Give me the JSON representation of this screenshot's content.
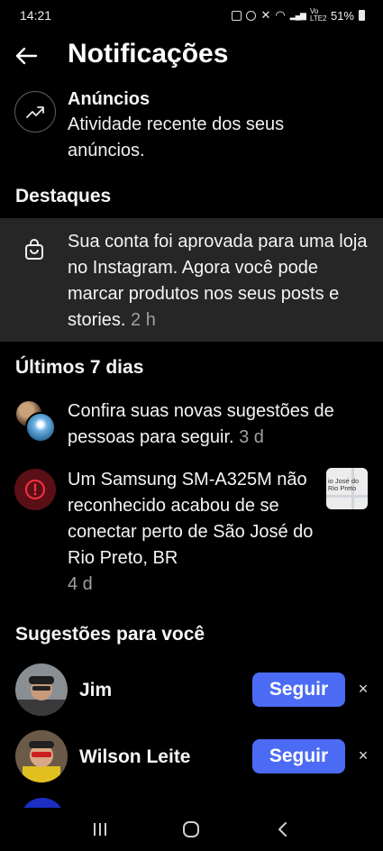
{
  "status_bar": {
    "time": "14:21",
    "signal_text": "Vo LTE2",
    "battery": "51%"
  },
  "header": {
    "title": "Notificações",
    "back_icon": "arrow-left-icon"
  },
  "ads": {
    "title": "Anúncios",
    "subtitle": "Atividade recente dos seus anúncios.",
    "icon": "trending-up-icon"
  },
  "sections": {
    "highlights": "Destaques",
    "last7days": "Últimos 7 dias",
    "suggestions": "Sugestões para você"
  },
  "highlight": {
    "icon": "shopping-bag-icon",
    "text": "Sua conta foi aprovada para uma loja no Instagram. Agora você pode marcar produtos nos seus posts e stories.",
    "time": "2 h"
  },
  "notifications": [
    {
      "text": "Confira suas novas sugestões de pessoas para seguir.",
      "time": "3 d"
    },
    {
      "icon": "alert-icon",
      "text": "Um Samsung SM-A325M não reconhecido acabou de se conectar perto de São José do Rio Preto, BR",
      "time": "4 d",
      "thumb_label": "io José do Rio Preto"
    }
  ],
  "suggestions": [
    {
      "name": "Jim",
      "button": "Seguir",
      "dismiss": "×"
    },
    {
      "name": "Wilson Leite",
      "button": "Seguir",
      "dismiss": "×"
    }
  ],
  "colors": {
    "background": "#000000",
    "highlight_bg": "#262626",
    "follow_button": "#4c6bf5",
    "alert_bg": "#5a0f16",
    "alert_fg": "#ff3040",
    "muted_text": "#a0a0a0"
  },
  "nav": {
    "recents_icon": "recents-icon",
    "home_icon": "home-icon",
    "back_icon": "back-chevron-icon"
  }
}
